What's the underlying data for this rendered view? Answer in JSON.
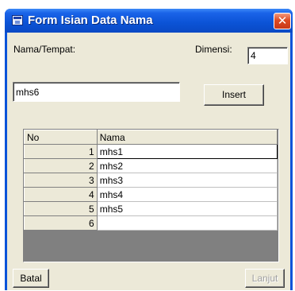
{
  "window": {
    "title": "Form Isian Data Nama",
    "close_glyph": "✕"
  },
  "form": {
    "nama_label": "Nama/Tempat:",
    "dimensi_label": "Dimensi:",
    "dimensi_value": "4",
    "nama_value": "mhs6",
    "insert_label": "Insert"
  },
  "grid": {
    "columns": [
      "No",
      "Nama"
    ],
    "rows": [
      {
        "no": "1",
        "nama": "mhs1"
      },
      {
        "no": "2",
        "nama": "mhs2"
      },
      {
        "no": "3",
        "nama": "mhs3"
      },
      {
        "no": "4",
        "nama": "mhs4"
      },
      {
        "no": "5",
        "nama": "mhs5"
      },
      {
        "no": "6",
        "nama": ""
      }
    ]
  },
  "footer": {
    "batal_label": "Batal",
    "lanjut_label": "Lanjut"
  },
  "colors": {
    "titlebar": "#0b53d6",
    "client_bg": "#ece9d8",
    "close_button": "#dd4a23"
  }
}
